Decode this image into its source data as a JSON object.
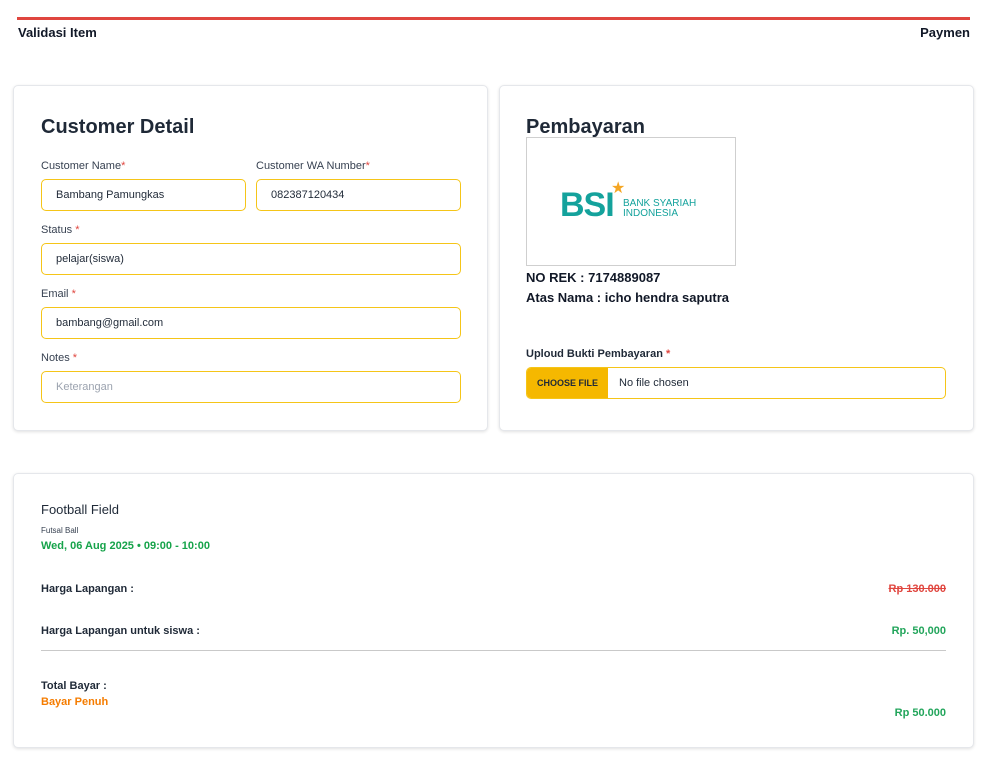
{
  "steps": {
    "left": "Validasi Item",
    "right": "Paymen"
  },
  "customer": {
    "title": "Customer Detail",
    "name_label": "Customer Name",
    "name_value": "Bambang Pamungkas",
    "wa_label": "Customer WA Number",
    "wa_value": "082387120434",
    "status_label": "Status ",
    "status_value": "pelajar(siswa)",
    "email_label": "Email ",
    "email_value": "bambang@gmail.com",
    "notes_label": "Notes ",
    "notes_placeholder": "Keterangan",
    "required_mark": "*"
  },
  "payment": {
    "title": "Pembayaran",
    "bank_logo_text": "BSI",
    "bank_line1": "BANK SYARIAH",
    "bank_line2": "INDONESIA",
    "rek": "NO REK : 7174889087",
    "atas_nama": "Atas Nama : icho hendra saputra",
    "upload_label": "Uploud Bukti Pembayaran ",
    "choose_file": "CHOOSE FILE",
    "no_file": "No file chosen"
  },
  "summary": {
    "field_name": "Football Field",
    "field_sub": "Futsal Ball",
    "date": "Wed, 06 Aug 2025 • 09:00 - 10:00",
    "harga_label": "Harga Lapangan :",
    "harga_value": "Rp 130.000",
    "siswa_label": "Harga Lapangan untuk siswa :",
    "siswa_value": "Rp. 50,000",
    "total_label": "Total Bayar :",
    "total_type": "Bayar Penuh",
    "total_value": "Rp 50.000"
  },
  "colors": {
    "accent_red": "#e0463f",
    "field_border": "#f5c518",
    "button_yellow": "#f5b800",
    "green": "#22a55b",
    "orange": "#f57c00",
    "bank_teal": "#14a29c"
  }
}
